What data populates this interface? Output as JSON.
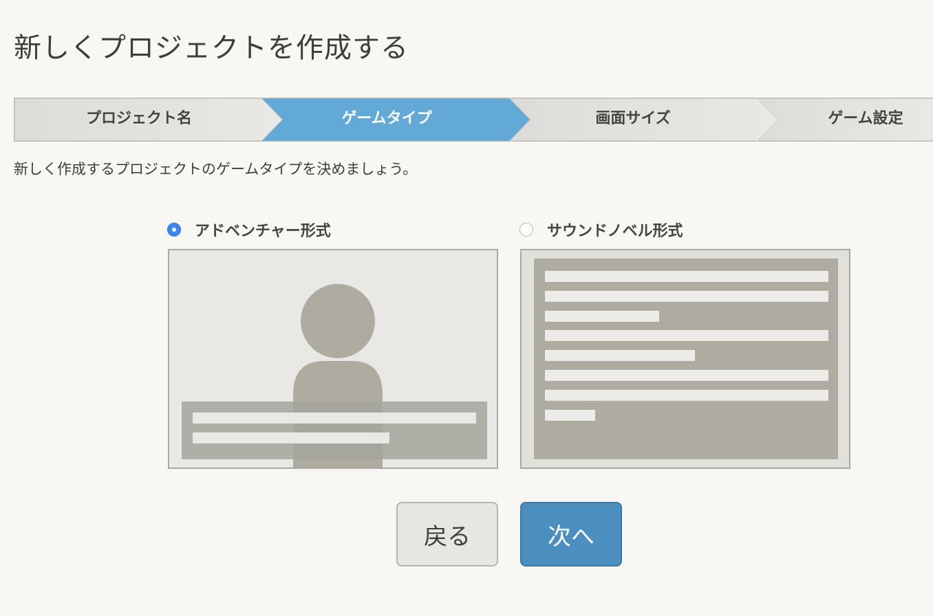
{
  "page": {
    "title": "新しくプロジェクトを作成する",
    "instruction": "新しく作成するプロジェクトのゲームタイプを決めましょう。"
  },
  "steps": [
    {
      "label": "プロジェクト名",
      "state": "done"
    },
    {
      "label": "ゲームタイプ",
      "state": "active"
    },
    {
      "label": "画面サイズ",
      "state": "pending"
    },
    {
      "label": "ゲーム設定",
      "state": "pending"
    }
  ],
  "game_types": {
    "selected": "adventure",
    "options": [
      {
        "id": "adventure",
        "label": "アドベンチャー形式",
        "checked": true
      },
      {
        "id": "sound-novel",
        "label": "サウンドノベル形式",
        "checked": false
      }
    ]
  },
  "buttons": {
    "back_label": "戻る",
    "next_label": "次へ"
  },
  "colors": {
    "background": "#f8f7f3",
    "step_active": "#62a9d8",
    "step_inactive": "#e2e2de",
    "radio_selected": "#3d86f4",
    "next_button": "#4a8fc0",
    "preview_dark": "#aeaca1",
    "preview_light": "#e9e8e4"
  }
}
